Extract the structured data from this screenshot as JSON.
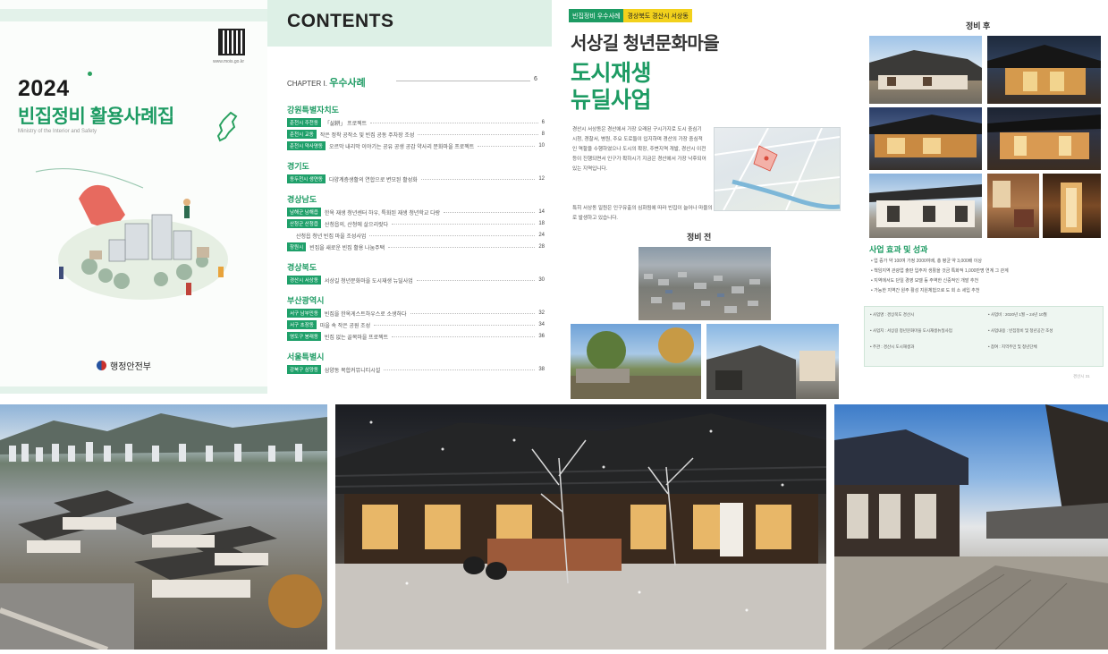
{
  "cover": {
    "qr_caption": "www.mois.go.kr",
    "year": "2024",
    "title": "빈집정비 활용사례집",
    "subtitle": "Ministry of the Interior and Safety",
    "publisher": "행정안전부"
  },
  "contents": {
    "title": "CONTENTS",
    "chapter_prefix": "CHAPTER Ⅰ.",
    "chapter_name": "우수사례",
    "chapter_page": "6",
    "sections": [
      {
        "region": "강원특별자치도",
        "entries": [
          {
            "tag": "춘천시 주천동",
            "text": "「삶耕」 프로젝트",
            "page": "6"
          },
          {
            "tag": "춘천시 교동",
            "text": "작은 정착 공작소 및 빈집 공동 주차장 조성",
            "page": "8"
          },
          {
            "tag": "춘천시 약사명동",
            "text": "오르막 내리막 이야기는 공유 공생 공감 약사리 문화마을 프로젝트",
            "page": "10"
          }
        ]
      },
      {
        "region": "경기도",
        "entries": [
          {
            "tag": "동두천시 생연동",
            "text": "다양계층생활의 연합으로 변모된 활성화",
            "page": "12"
          }
        ]
      },
      {
        "region": "경상남도",
        "entries": [
          {
            "tag": "남해군 남해읍",
            "text": "한옥 재생 청년센터 하우, 특화된 재생 청년학교 다랑",
            "page": "14"
          },
          {
            "tag": "산청군 산청읍",
            "text": "산청읍의, 산청에 살으리랏다",
            "page": "18"
          },
          {
            "tag": "",
            "text": "산청읍 청년 빈집 마을 조성사업",
            "page": "24"
          },
          {
            "tag": "창원시",
            "text": "빈집을 새로운 빈집 활용 나눔주택",
            "page": "28"
          }
        ]
      },
      {
        "region": "경상북도",
        "entries": [
          {
            "tag": "경산시 서상동",
            "text": "서상길 청년문화마을 도시재생 뉴딜사업",
            "page": "30"
          }
        ]
      },
      {
        "region": "부산광역시",
        "entries": [
          {
            "tag": "서구 남부민동",
            "text": "빈집을 한옥게스트하우스로 소생하다",
            "page": "32"
          },
          {
            "tag": "서구 초장동",
            "text": "마을 속 작은 공원 조성",
            "page": "34"
          },
          {
            "tag": "영도구 봉래동",
            "text": "빈집 없는 골목마을 프로젝트",
            "page": "36"
          }
        ]
      },
      {
        "region": "서울특별시",
        "entries": [
          {
            "tag": "강북구 삼양동",
            "text": "삼양동 복합커뮤니티시설",
            "page": "38"
          }
        ]
      }
    ]
  },
  "case": {
    "badge_1": "빈집정비 우수사례",
    "badge_2": "경상북도 경산시 서상동",
    "title_line1": "서상길 청년문화마을",
    "title_line2": "도시재생",
    "title_line3": "뉴딜사업",
    "body": "경산시 서상동은 경산에서 가장 오래된 구시가지로 도시 중심기 시청, 경찰서, 병원, 주요 도로들이 입지하며 경산의 가장 중심적인 역할을 수행하였으나 도시의 확장, 주변지역 개발, 경산시 이전 등이 진행되면서 인구가 확하시기 지금은 경산에서 가장 낙후되어 있는 지역입니다.",
    "body2": "특히 서상동 일원은 인구유출의 심화됨에 따라 빈집이 늘어나 마을의 외관상에도 매우 좋지 않고 안전, 위생 등의 문제도 지속적으로 발생하고 있습니다.",
    "before_label": "정비 전"
  },
  "after": {
    "title": "정비 후",
    "effects_title": "사업 효과 및 성과",
    "effects": [
      "• 업 증가 약 100여 가정 2000여배, 총 평균 약 3,000배 이상",
      "• 책임지역 관광업 출판 입주자 생활을 것금 특화적 1,000만명 연계 그 관계",
      "• 지역에서도 단일 경영 모델 등 주역한 신중적인 개발 추천",
      "• 가능한 지역간 원주 활성 지원체험으로 도 회 소 세입 추천"
    ],
    "info": [
      "• 사업명 : 경상북도 경산시",
      "• 사업비 : 2020년 1월 ~ 24년 10월",
      "• 사업지 : 서상길 청년문화마을 도시재생뉴딜사업",
      "• 사업내용 : 빈집정비 및 청년공간 조성",
      "• 주관 : 경산시 도시재생과",
      "• 참여 : 지역주민 및 청년단체"
    ],
    "page_no": "경산시 31"
  },
  "colors": {
    "brand_green": "#1d9b63",
    "light_green": "#ddf0e6",
    "yellow": "#f2d11c"
  }
}
